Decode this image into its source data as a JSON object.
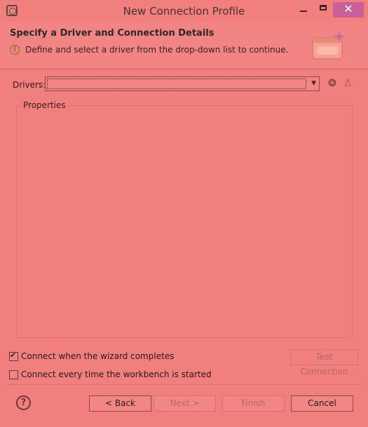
{
  "window": {
    "title": "New Connection Profile",
    "close_glyph": "✕"
  },
  "header": {
    "title": "Specify a Driver and Connection Details",
    "message": "Define and select a driver from the drop-down list to continue.",
    "info_glyph": "i"
  },
  "drivers": {
    "label": "Drivers:",
    "selected_value": "",
    "new_icon": "new-driver-icon",
    "edit_icon": "edit-driver-icon"
  },
  "properties": {
    "label": "Properties"
  },
  "options": {
    "connect_on_finish": {
      "label": "Connect when the wizard completes",
      "checked": true
    },
    "connect_on_startup": {
      "label": "Connect every time the workbench is started",
      "checked": false
    }
  },
  "buttons": {
    "test_connection": "Test Connection",
    "back": "< Back",
    "next": "Next >",
    "finish": "Finish",
    "cancel": "Cancel",
    "help_glyph": "?"
  },
  "colors": {
    "background": "#f07f7d",
    "close_button": "#c8609c",
    "header_band": "#f28583"
  }
}
